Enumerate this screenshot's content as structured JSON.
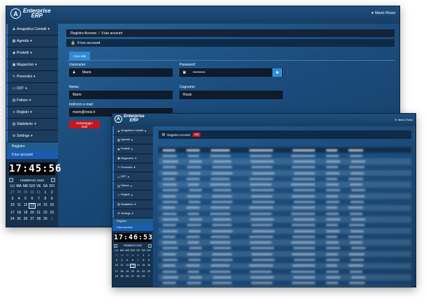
{
  "app": {
    "logo_symbol": "A",
    "logo_line1": "Enterprise",
    "logo_line2": "ERP",
    "user_name": "Mario Rossi",
    "user_icon": "user-icon"
  },
  "sidebar": {
    "items": [
      {
        "label": "Anagrafica Contatti",
        "icon": "users-icon",
        "glyph": "♟"
      },
      {
        "label": "Agenda",
        "icon": "calendar-icon",
        "glyph": "▦"
      },
      {
        "label": "Prodotti",
        "icon": "tag-icon",
        "glyph": "◆"
      },
      {
        "label": "Magazzino",
        "icon": "warehouse-icon",
        "glyph": "▣"
      },
      {
        "label": "Preventivi",
        "icon": "edit-icon",
        "glyph": "✎"
      },
      {
        "label": "DDT",
        "icon": "truck-icon",
        "glyph": "▭"
      },
      {
        "label": "Fatture",
        "icon": "invoice-icon",
        "glyph": "▤"
      },
      {
        "label": "Registri",
        "icon": "list-icon",
        "glyph": "≡"
      },
      {
        "label": "Statistiche",
        "icon": "chart-icon",
        "glyph": "▥"
      },
      {
        "label": "Settings",
        "icon": "gear-icon",
        "glyph": "⚙"
      }
    ],
    "subitems": [
      {
        "label": "Registro"
      },
      {
        "label": "Il tuo account"
      }
    ],
    "caret": "▾"
  },
  "clock": {
    "time_w1": "17:45:56",
    "time_w2": "17:46:53"
  },
  "calendar": {
    "month": "FEBBRAIO 2020",
    "prev": "‹",
    "next": "›",
    "weekdays": [
      "LU",
      "MA",
      "ME",
      "GIO",
      "VE",
      "SA",
      "DO"
    ],
    "weeks": [
      [
        {
          "d": "27",
          "dim": true
        },
        {
          "d": "28",
          "dim": true
        },
        {
          "d": "29",
          "dim": true
        },
        {
          "d": "30",
          "dim": true
        },
        {
          "d": "31",
          "dim": true
        },
        {
          "d": "1"
        },
        {
          "d": "2"
        }
      ],
      [
        {
          "d": "3"
        },
        {
          "d": "4"
        },
        {
          "d": "5"
        },
        {
          "d": "6"
        },
        {
          "d": "7"
        },
        {
          "d": "8"
        },
        {
          "d": "9"
        }
      ],
      [
        {
          "d": "10"
        },
        {
          "d": "11"
        },
        {
          "d": "12"
        },
        {
          "d": "13",
          "today": true
        },
        {
          "d": "14"
        },
        {
          "d": "15"
        },
        {
          "d": "16"
        }
      ],
      [
        {
          "d": "17"
        },
        {
          "d": "18"
        },
        {
          "d": "19"
        },
        {
          "d": "20"
        },
        {
          "d": "21"
        },
        {
          "d": "22"
        },
        {
          "d": "23"
        }
      ],
      [
        {
          "d": "24"
        },
        {
          "d": "25"
        },
        {
          "d": "26"
        },
        {
          "d": "27"
        },
        {
          "d": "28"
        },
        {
          "d": "29"
        },
        {
          "d": "1",
          "dim": true
        }
      ]
    ]
  },
  "account_page": {
    "breadcrumb_parent": "Registro Accessi",
    "breadcrumb_sep": "/",
    "breadcrumb_current": "Il tuo account",
    "panel_title": "Il tuo account",
    "tab_label": "I tuoi dati",
    "username_label": "Username:",
    "username_value": "Mario",
    "password_label": "Password:",
    "password_value": "••••••••••",
    "nome_label": "Nome:",
    "nome_value": "Mario",
    "cognome_label": "Cognome:",
    "cognome_value": "Rossi",
    "email_label": "Indirizzo e-mail:",
    "email_value": "mario@rossi.it",
    "save_label": "Salvataggio Dati"
  },
  "registry_page": {
    "panel_title": "Registro Accessi",
    "badge_count": "158"
  },
  "colors": {
    "accent": "#3288d3",
    "danger": "#c8151d",
    "sidebar": "#16314e",
    "topbar": "#1d4f7e"
  }
}
